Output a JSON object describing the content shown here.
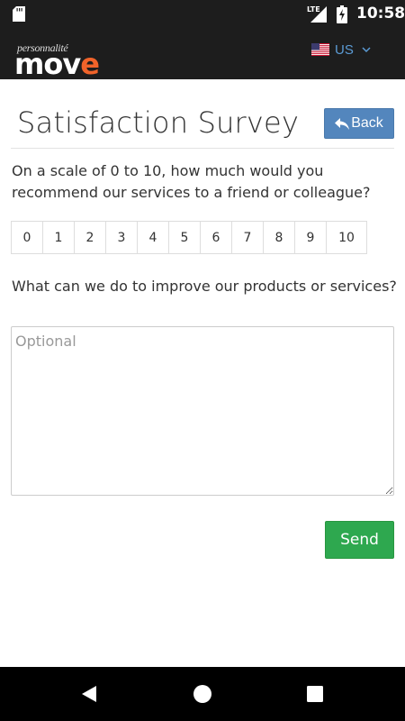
{
  "status_bar": {
    "time": "10:58",
    "network": "LTE",
    "icons": [
      "sd-card-icon",
      "signal-icon",
      "battery-charging-icon"
    ]
  },
  "header": {
    "logo_small": "personnalité",
    "logo_word": "mov",
    "logo_accent": "e",
    "language": "US",
    "flag": "us-flag-icon",
    "brand_color": "#f0632a",
    "link_color": "#5b9bd5"
  },
  "page": {
    "title": "Satisfaction Survey",
    "back_label": "Back",
    "question1": "On a scale of 0 to 10, how much would you recommend our services to a friend or colleague?",
    "scale": [
      "0",
      "1",
      "2",
      "3",
      "4",
      "5",
      "6",
      "7",
      "8",
      "9",
      "10"
    ],
    "question2": "What can we do to improve our products or services?",
    "feedback_placeholder": "Optional",
    "feedback_value": "",
    "send_label": "Send",
    "back_color": "#5386bd",
    "send_color": "#2ea84f"
  },
  "nav_bar": {
    "icons": [
      "back-triangle-icon",
      "home-circle-icon",
      "recents-square-icon"
    ]
  }
}
